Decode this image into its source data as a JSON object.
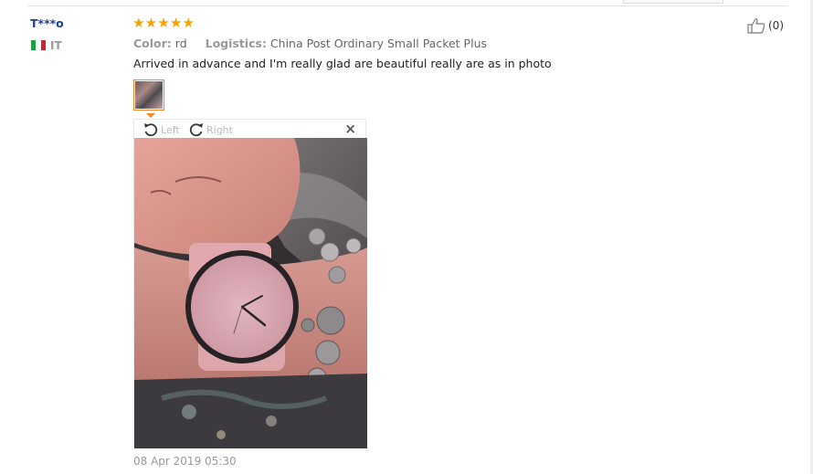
{
  "review": {
    "user_name": "T***o",
    "country_code": "IT",
    "flag_colors": [
      "#1f9e48",
      "#ffffff",
      "#d2232a"
    ],
    "rating": 5,
    "stars": [
      "★",
      "★",
      "★",
      "★",
      "★"
    ],
    "color_label": "Color:",
    "color_value": "rd",
    "logistics_label": "Logistics:",
    "logistics_value": "China Post Ordinary Small Packet Plus",
    "text": "Arrived in advance and I'm really glad are beautiful really are as in photo",
    "date": "08 Apr 2019 05:30",
    "helpful_count": "(0)",
    "accent_color": "#f08a24",
    "star_color": "#f6a200"
  },
  "viewer": {
    "rotate_left_label": "Left",
    "rotate_right_label": "Right",
    "close_label": "×",
    "photo_alt": "Review photo"
  }
}
